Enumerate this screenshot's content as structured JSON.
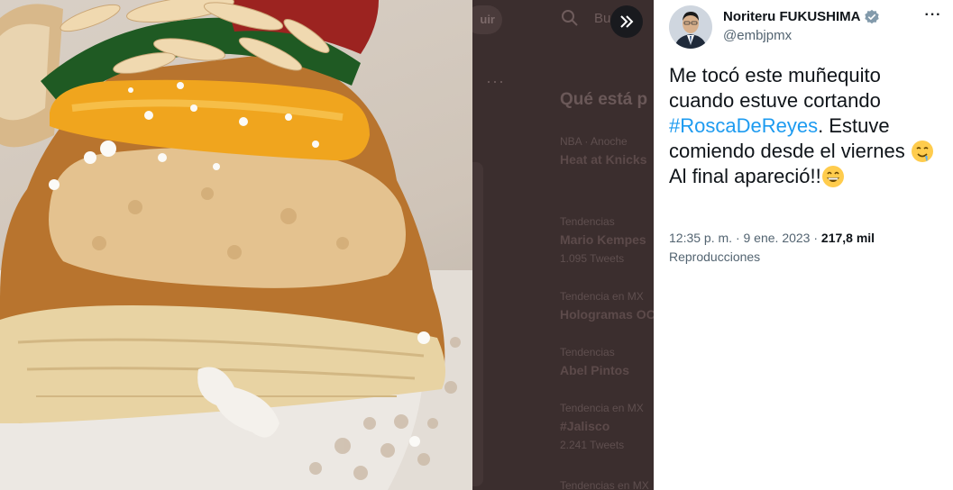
{
  "photo": {
    "icon": "rosca-de-reyes-photo"
  },
  "background_page": {
    "button_label": "uir",
    "search_placeholder": "Bu",
    "more_menu": "···",
    "trends_heading": "Qué está p",
    "trends": [
      {
        "context": "NBA · Anoche",
        "title": "Heat at Knicks",
        "count": ""
      },
      {
        "context": "Tendencias",
        "title": "Mario Kempes",
        "count": "1.095 Tweets"
      },
      {
        "context": "Tendencia en MX",
        "title": "Hologramas OC",
        "count": ""
      },
      {
        "context": "Tendencias",
        "title": "Abel Pintos",
        "count": ""
      },
      {
        "context": "Tendencia en MX",
        "title": "#Jalisco",
        "count": "2.241 Tweets"
      },
      {
        "context": "Tendencias en MX",
        "title": "",
        "count": ""
      }
    ]
  },
  "expand_button": {
    "icon": "double-chevron-right-icon"
  },
  "tweet": {
    "author_name": "Noriteru FUKUSHIMA",
    "verified_icon": "verified-badge-icon",
    "handle": "@embjpmx",
    "more_icon": "···",
    "text_part1": "Me tocó este muñequito cuando estuve cortando ",
    "hashtag": "#RoscaDeReyes",
    "text_part2": ". Estuve comiendo desde el viernes ",
    "emoji1": "drooling-face-emoji",
    "text_part3": "Al final apareció!!",
    "emoji2": "grinning-face-emoji",
    "time": "12:35 p. m.",
    "separator": "·",
    "date": "9 ene. 2023",
    "separator2": "·",
    "views_count": "217,8 mil",
    "views_label": "Reproducciones",
    "colors": {
      "accent": "#1d9bf0",
      "text": "#0f1419",
      "secondary": "#536471"
    }
  }
}
